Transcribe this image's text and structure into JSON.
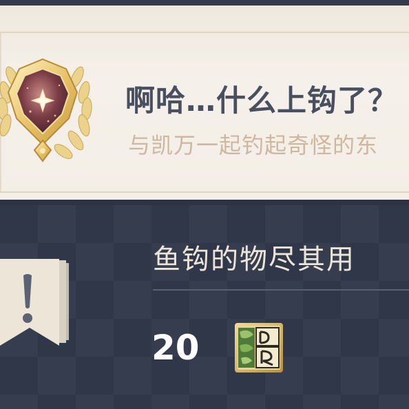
{
  "achievement": {
    "title": "啊哈…什么上钩了？",
    "description": "与凯万一起钓起奇怪的东",
    "badge_icon": "star-medal-icon"
  },
  "task": {
    "title": "鱼钩的物尽其用",
    "banner_icon": "exclamation-banner-icon",
    "reward": {
      "count": "20",
      "icon": "cube-item-icon"
    }
  },
  "colors": {
    "card_background": "#f3eee6",
    "title_text": "#484f5f",
    "description_text": "#cdb89f",
    "panel_background": "#2f3749",
    "panel_text": "#ece5d8",
    "gold": "#e7c77a"
  }
}
